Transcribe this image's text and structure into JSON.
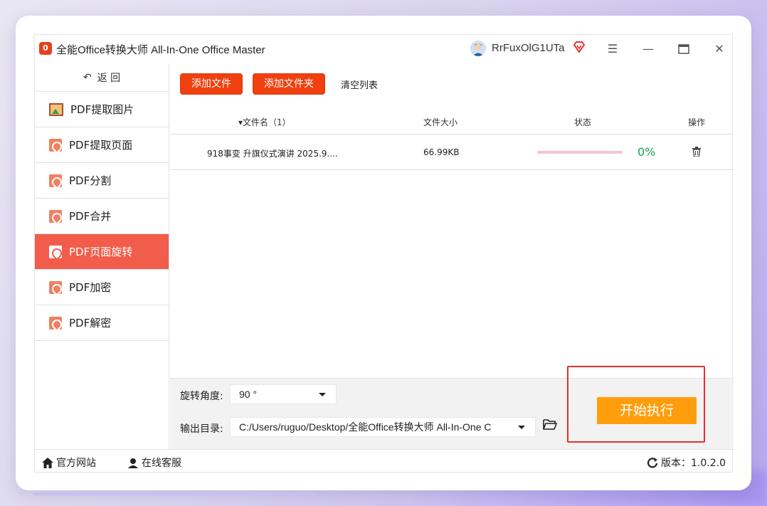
{
  "window": {
    "title": "全能Office转换大师 All-In-One Office Master",
    "user_name": "RrFuxOlG1UTa",
    "logo_text": "0"
  },
  "sidebar": {
    "back_label": "返 回",
    "items": [
      {
        "label": "PDF提取图片",
        "icon": "image-icon"
      },
      {
        "label": "PDF提取页面",
        "icon": "pdf-icon"
      },
      {
        "label": "PDF分割",
        "icon": "pdf-icon"
      },
      {
        "label": "PDF合并",
        "icon": "pdf-icon"
      },
      {
        "label": "PDF页面旋转",
        "icon": "pdf-icon",
        "active": true
      },
      {
        "label": "PDF加密",
        "icon": "pdf-icon"
      },
      {
        "label": "PDF解密",
        "icon": "pdf-icon"
      }
    ]
  },
  "toolbar": {
    "add_file": "添加文件",
    "add_folder": "添加文件夹",
    "clear_list": "清空列表"
  },
  "table": {
    "col_name": "文件名（1）",
    "col_size": "文件大小",
    "col_status": "状态",
    "col_action": "操作",
    "rows": [
      {
        "name": "918事变 升旗仪式演讲 2025.9....",
        "size": "66.99KB",
        "progress": 0,
        "progress_text": "0%"
      }
    ]
  },
  "settings": {
    "angle_label": "旋转角度:",
    "angle_value": "90 °",
    "output_label": "输出目录:",
    "output_value": "C:/Users/ruguo/Desktop/全能Office转换大师 All-In-One C",
    "start_button": "开始执行"
  },
  "footer": {
    "website": "官方网站",
    "support": "在线客服",
    "version": "版本：1.0.2.0"
  },
  "colors": {
    "accent_red": "#f0400f",
    "active_sidebar": "#f25c4a",
    "start_orange": "#ff9d0d",
    "progress_green": "#1aa34a"
  }
}
